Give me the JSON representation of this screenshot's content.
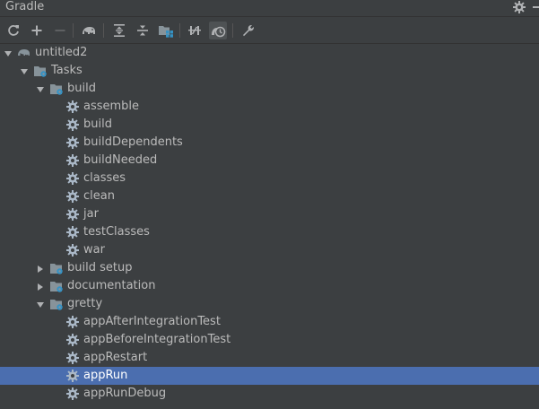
{
  "window": {
    "title": "Gradle"
  },
  "toolbar": {
    "buttons": [
      {
        "icon": "refresh-icon"
      },
      {
        "icon": "plus-icon"
      },
      {
        "icon": "minus-icon"
      },
      {
        "icon": "elephant-icon"
      },
      {
        "icon": "expand-all-icon"
      },
      {
        "icon": "collapse-all-icon"
      },
      {
        "icon": "group-modules-icon"
      },
      {
        "icon": "toggle-offline-icon"
      },
      {
        "icon": "show-tasks-icon"
      },
      {
        "icon": "wrench-icon"
      }
    ]
  },
  "tree": {
    "items": [
      {
        "label": "untitled2",
        "depth": 0,
        "kind": "project",
        "state": "expanded"
      },
      {
        "label": "Tasks",
        "depth": 1,
        "kind": "folder",
        "state": "expanded"
      },
      {
        "label": "build",
        "depth": 2,
        "kind": "folder",
        "state": "expanded"
      },
      {
        "label": "assemble",
        "depth": 3,
        "kind": "task"
      },
      {
        "label": "build",
        "depth": 3,
        "kind": "task"
      },
      {
        "label": "buildDependents",
        "depth": 3,
        "kind": "task"
      },
      {
        "label": "buildNeeded",
        "depth": 3,
        "kind": "task"
      },
      {
        "label": "classes",
        "depth": 3,
        "kind": "task"
      },
      {
        "label": "clean",
        "depth": 3,
        "kind": "task"
      },
      {
        "label": "jar",
        "depth": 3,
        "kind": "task"
      },
      {
        "label": "testClasses",
        "depth": 3,
        "kind": "task"
      },
      {
        "label": "war",
        "depth": 3,
        "kind": "task"
      },
      {
        "label": "build setup",
        "depth": 2,
        "kind": "folder",
        "state": "collapsed"
      },
      {
        "label": "documentation",
        "depth": 2,
        "kind": "folder",
        "state": "collapsed"
      },
      {
        "label": "gretty",
        "depth": 2,
        "kind": "folder",
        "state": "expanded"
      },
      {
        "label": "appAfterIntegrationTest",
        "depth": 3,
        "kind": "task"
      },
      {
        "label": "appBeforeIntegrationTest",
        "depth": 3,
        "kind": "task"
      },
      {
        "label": "appRestart",
        "depth": 3,
        "kind": "task"
      },
      {
        "label": "appRun",
        "depth": 3,
        "kind": "task",
        "selected": true
      },
      {
        "label": "appRunDebug",
        "depth": 3,
        "kind": "task"
      }
    ]
  },
  "colors": {
    "background": "#3c3f41",
    "selection": "#4b6eaf",
    "text": "#bbbbbb",
    "folder": "#87939a",
    "folder_badge": "#3592c4"
  }
}
